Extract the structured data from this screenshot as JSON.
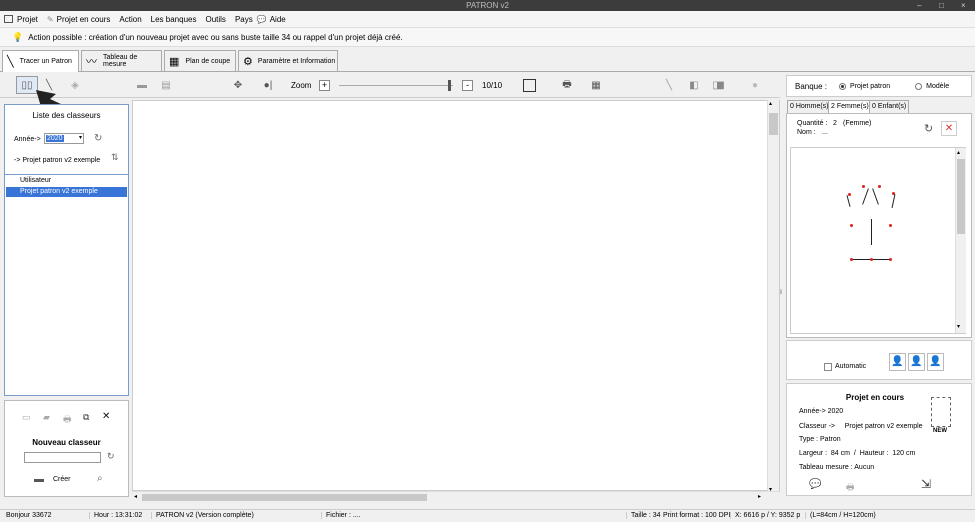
{
  "window": {
    "title": "PATRON v2"
  },
  "menu": {
    "items": [
      "Projet",
      "Projet en cours",
      "Action",
      "Les banques",
      "Outils",
      "Pays",
      "Aide"
    ]
  },
  "info_message": "Action possible : création d'un nouveau projet avec ou sans buste taille 34 ou rappel d'un projet déjà créé.",
  "main_tabs": [
    {
      "label": "Tracer un Patron",
      "icon": "pencil-icon"
    },
    {
      "label": "Tableau de mesure",
      "icon": "measure-icon"
    },
    {
      "label": "Plan de coupe",
      "icon": "cut-plan-icon"
    },
    {
      "label": "Paramètre et Information",
      "icon": "gears-icon"
    }
  ],
  "toolbar": {
    "zoom_label": "Zoom",
    "zoom_plus": "+",
    "zoom_minus": "-",
    "page_counter": "10/10"
  },
  "left_panel": {
    "title": "Liste des classeurs",
    "year_label": "Année->",
    "year_value": "2020",
    "project_link": "-> Projet patron v2 exemple",
    "tree": [
      {
        "label": "Utilisateur",
        "selected": false
      },
      {
        "label": "Projet patron v2 exemple",
        "selected": true
      }
    ]
  },
  "new_binder": {
    "title": "Nouveau classeur",
    "input_value": "",
    "create_label": "Créer"
  },
  "right_panel": {
    "bank_label": "Banque :",
    "bank_options": [
      {
        "label": "Projet patron",
        "selected": true
      },
      {
        "label": "Modèle",
        "selected": false
      }
    ],
    "tabs": [
      {
        "label": "0 Homme(s)",
        "active": false
      },
      {
        "label": "2 Femme(s)",
        "active": true
      },
      {
        "label": "0 Enfant(s)",
        "active": false
      }
    ],
    "quantity_label": "Quantité :",
    "quantity_value": "2",
    "quantity_unit": "(Femme)",
    "name_label": "Nom :",
    "name_value": "...",
    "auto_label": "Automatic"
  },
  "project_current": {
    "title": "Projet en cours",
    "year": "Année->  2020",
    "binder": "Classeur ->     Projet patron v2 exemple",
    "type": "Type :  Patron",
    "size": "Largeur :  84 cm  /  Hauteur :  120 cm",
    "measure_table": "Tableau mesure :  Aucun",
    "badge": "NEW"
  },
  "statusbar": {
    "greeting": "Bonjour 33672",
    "hour": "Hour : 13:31:02",
    "version": "PATRON v2 (Version complète)",
    "file": "Fichier : ....",
    "size": "Taille : 34",
    "print_format": "Print format : 100 DPI",
    "coords": "X: 6616 p  /  Y: 9352 p",
    "dims": "(L=84cm / H=120cm)"
  }
}
